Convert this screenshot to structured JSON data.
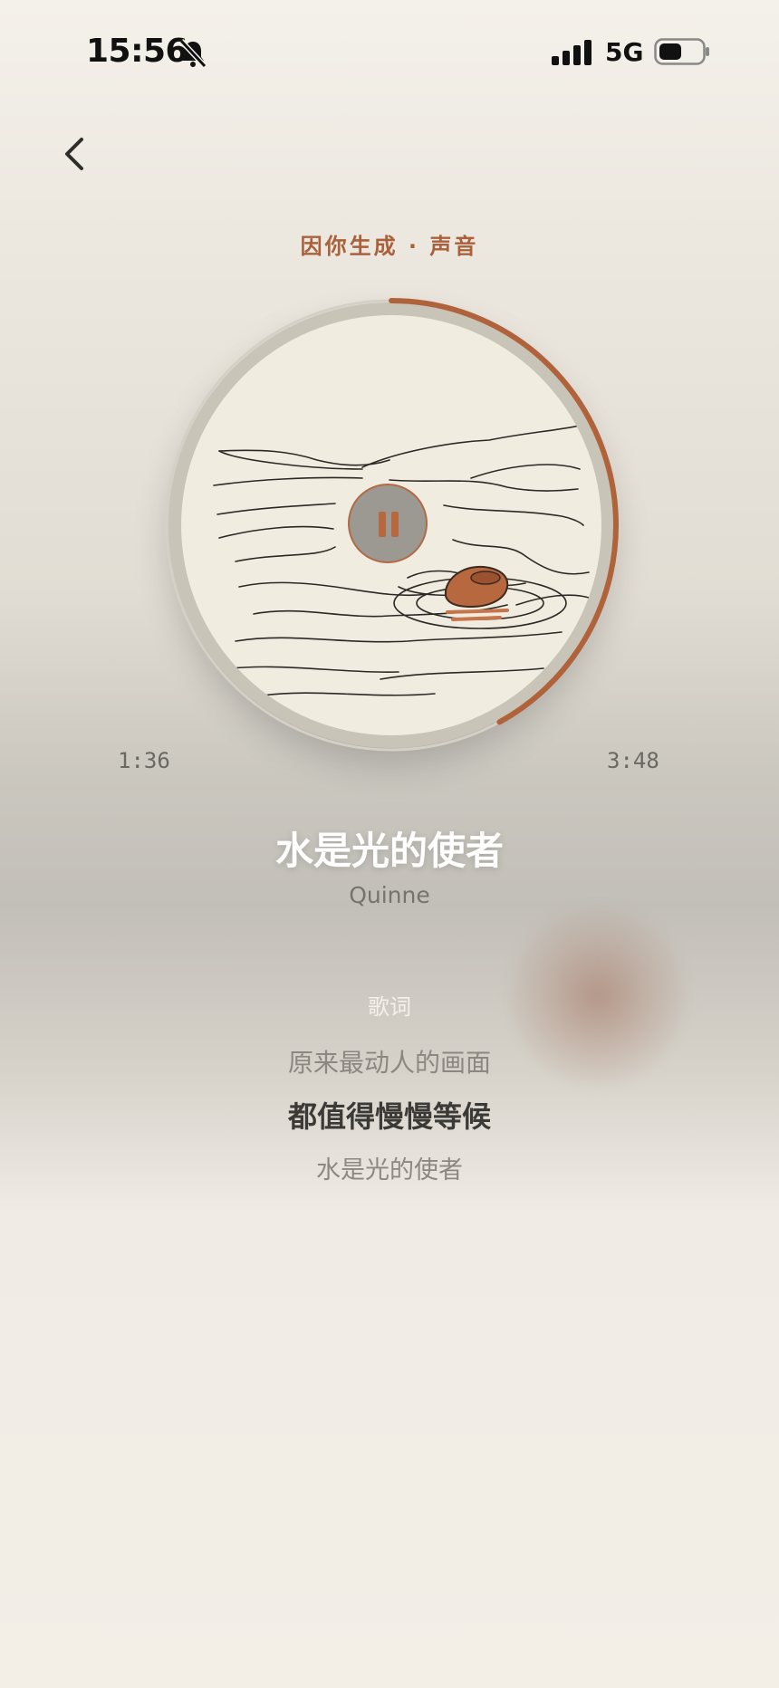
{
  "status_bar": {
    "time": "15:56",
    "network": "5G",
    "icons": [
      "bell-slash-icon",
      "signal-bars-icon",
      "battery-icon"
    ]
  },
  "header": {
    "back_icon": "chevron-left-icon",
    "source_label": "因你生成 · 声音"
  },
  "player": {
    "current_time": "1:36",
    "total_time": "3:48",
    "progress": 0.42,
    "state": "playing",
    "pause_icon": "pause-icon",
    "artwork_icon": "water-ripple-stone-illustration"
  },
  "track": {
    "title": "水是光的使者",
    "artist": "Quinne"
  },
  "lyrics": {
    "heading": "歌词",
    "previous_line": "原来最动人的画面",
    "current_line": "都值得慢慢等候",
    "next_line": "水是光的使者"
  },
  "colors": {
    "accent": "#b0623a",
    "background": "#f3efe7",
    "text_dark": "#3c3a37"
  }
}
